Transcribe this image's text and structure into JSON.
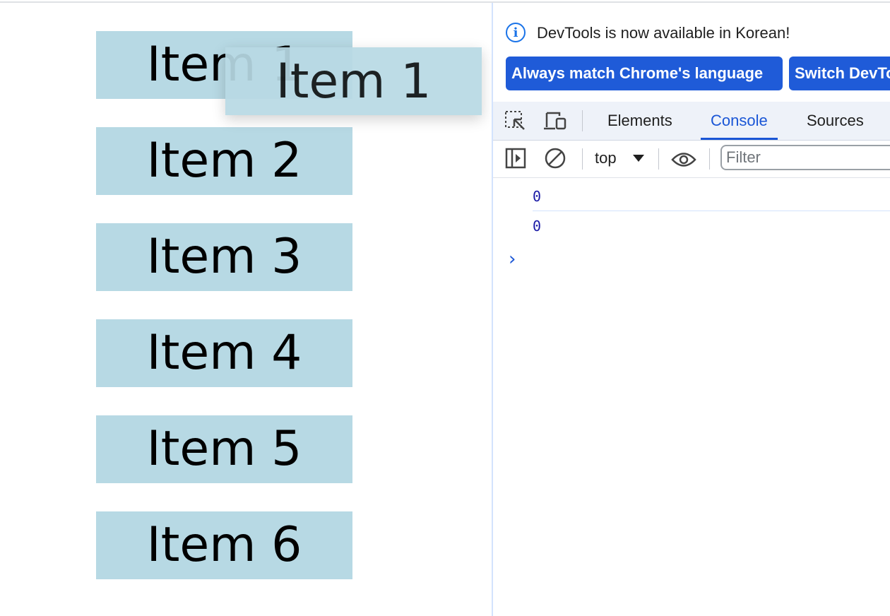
{
  "page": {
    "items": [
      {
        "label": "Item 1"
      },
      {
        "label": "Item 2"
      },
      {
        "label": "Item 3"
      },
      {
        "label": "Item 4"
      },
      {
        "label": "Item 5"
      },
      {
        "label": "Item 6"
      }
    ],
    "drag_ghost_label": "Item 1",
    "item_color": "#b7d9e4"
  },
  "devtools": {
    "infobar": {
      "icon": "info-icon",
      "message": "DevTools is now available in Korean!",
      "match_button": "Always match Chrome's language",
      "switch_button": "Switch DevTools to Korean"
    },
    "tabs": [
      {
        "label": "Elements",
        "active": false
      },
      {
        "label": "Console",
        "active": true
      },
      {
        "label": "Sources",
        "active": false
      }
    ],
    "toolbar": {
      "context": "top",
      "filter_placeholder": "Filter"
    },
    "console": {
      "messages": [
        "0",
        "0"
      ],
      "prompt": "›"
    },
    "accent_color": "#1a56d6"
  }
}
